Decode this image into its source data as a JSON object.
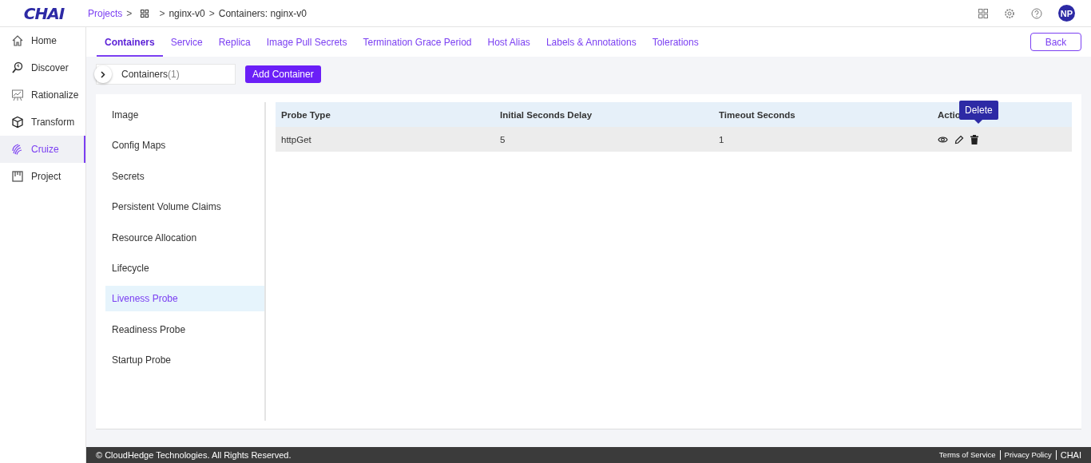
{
  "logo": "CHAI",
  "breadcrumb": [
    {
      "kind": "link",
      "label": "Projects"
    },
    {
      "kind": "separator",
      "label": ">"
    },
    {
      "kind": "grid"
    },
    {
      "kind": "separator",
      "label": ">"
    },
    {
      "kind": "text",
      "label": "nginx-v0"
    },
    {
      "kind": "separator",
      "label": ">"
    },
    {
      "kind": "text",
      "label": "Containers: nginx-v0"
    }
  ],
  "user": {
    "initials": "NP"
  },
  "sidebar": {
    "items": [
      {
        "label": "Home",
        "selected": false
      },
      {
        "label": "Discover",
        "selected": false
      },
      {
        "label": "Rationalize",
        "selected": false
      },
      {
        "label": "Transform",
        "selected": false
      },
      {
        "label": "Cruize",
        "selected": true
      },
      {
        "label": "Project",
        "selected": false
      }
    ]
  },
  "tabs": [
    {
      "label": "Containers",
      "selected": true
    },
    {
      "label": "Service",
      "selected": false
    },
    {
      "label": "Replica",
      "selected": false
    },
    {
      "label": "Image Pull Secrets",
      "selected": false
    },
    {
      "label": "Termination Grace Period",
      "selected": false
    },
    {
      "label": "Host Alias",
      "selected": false
    },
    {
      "label": "Labels & Annotations",
      "selected": false
    },
    {
      "label": "Tolerations",
      "selected": false
    }
  ],
  "back_button": "Back",
  "containers_selector": {
    "label": "Containers",
    "count": "(1)"
  },
  "add_button": "Add Container",
  "sections": [
    {
      "label": "Image",
      "selected": false
    },
    {
      "label": "Config Maps",
      "selected": false
    },
    {
      "label": "Secrets",
      "selected": false
    },
    {
      "label": "Persistent Volume Claims",
      "selected": false
    },
    {
      "label": "Resource Allocation",
      "selected": false
    },
    {
      "label": "Lifecycle",
      "selected": false
    },
    {
      "label": "Liveness Probe",
      "selected": true
    },
    {
      "label": "Readiness Probe",
      "selected": false
    },
    {
      "label": "Startup Probe",
      "selected": false
    }
  ],
  "table": {
    "columns": [
      "Probe Type",
      "Initial Seconds Delay",
      "Timeout Seconds",
      "Actio"
    ],
    "rows": [
      {
        "cells": [
          "httpGet",
          "5",
          "1"
        ]
      }
    ]
  },
  "tooltip": "Delete",
  "footer": {
    "copyright": "© CloudHedge Technologies. All Rights Reserved.",
    "links": [
      "Terms of Service",
      "Privacy Policy",
      "CHAI"
    ]
  }
}
